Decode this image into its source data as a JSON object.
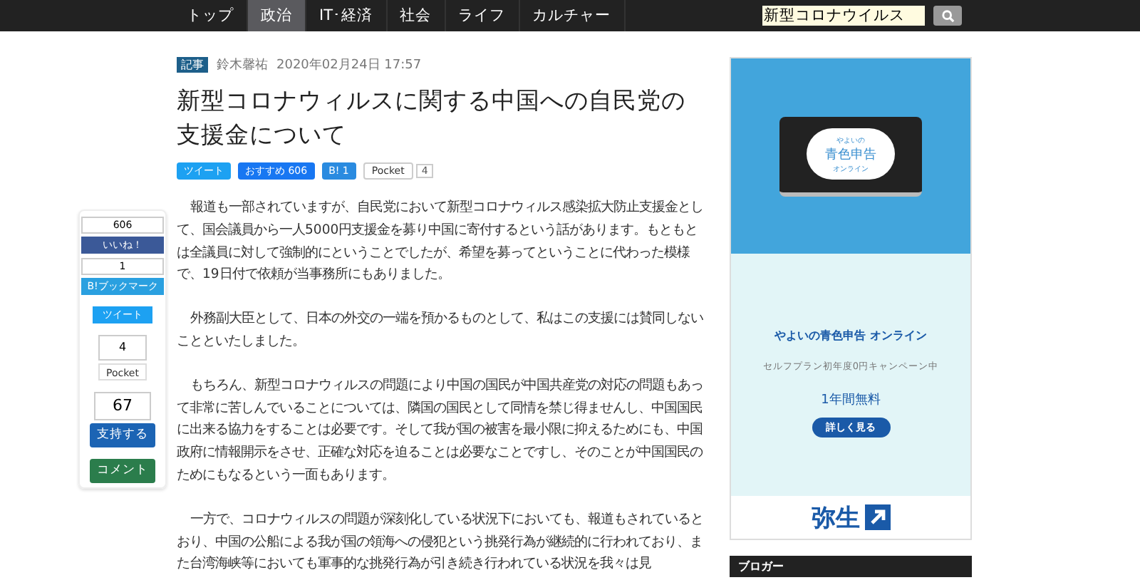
{
  "nav": {
    "items": [
      {
        "label": "トップ",
        "selected": false
      },
      {
        "label": "政治",
        "selected": true
      },
      {
        "label": "IT･経済",
        "selected": false
      },
      {
        "label": "社会",
        "selected": false
      },
      {
        "label": "ライフ",
        "selected": false
      },
      {
        "label": "カルチャー",
        "selected": false
      }
    ],
    "search": {
      "value": "新型コロナウイルス"
    }
  },
  "article": {
    "badge": "記事",
    "author": "鈴木馨祐",
    "date": "2020年02月24日 17:57",
    "title": "新型コロナウィルスに関する中国への自民党の支援金について",
    "share": [
      {
        "kind": "twitter",
        "label": "ツイート"
      },
      {
        "kind": "facebook",
        "label": "おすすめ",
        "count": "606"
      },
      {
        "kind": "hatena",
        "label": "B!",
        "count": "1"
      },
      {
        "kind": "pocket",
        "label": "Pocket",
        "count": "4"
      }
    ],
    "paragraphs": [
      "報道も一部されていますが、自民党において新型コロナウィルス感染拡大防止支援金として、国会議員から一人5000円支援金を募り中国に寄付するという話があります。もともとは全議員に対して強制的にということでしたが、希望を募ってということに代わった模様で、19日付で依頼が当事務所にもありました。",
      "外務副大臣として、日本の外交の一端を預かるものとして、私はこの支援には賛同しないことといたしました。",
      "もちろん、新型コロナウィルスの問題により中国の国民が中国共産党の対応の問題もあって非常に苦しんでいることについては、隣国の国民として同情を禁じ得ませんし、中国国民に出来る協力をすることは必要です。そして我が国の被害を最小限に抑えるためにも、中国政府に情報開示をさせ、正確な対応を迫ることは必要なことですし、そのことが中国国民のためにもなるという一面もあります。",
      "一方で、コロナウィルスの問題が深刻化している状況下においても、報道もされているとおり、中国の公船による我が国の領海への侵犯という挑発行為が継続的に行われており、また台湾海峡等においても軍事的な挑発行為が引き続き行われている状況を我々は見"
    ]
  },
  "side_share": {
    "like_count": "606",
    "like_label": "いいね！",
    "hatena_count": "1",
    "hatena_label": "B!ブックマーク",
    "tweet_label": "ツイート",
    "pocket_count": "4",
    "pocket_label": "Pocket",
    "support_count": "67",
    "support_label": "支持する",
    "comment_label": "コメント"
  },
  "ad": {
    "image_small": "やよいの",
    "image_title": "青色申告",
    "image_sub": "オンライン",
    "headline": "やよいの青色申告 オンライン",
    "campaign": "セルフプラン初年度0円キャンペーン中",
    "offer": "1年間無料",
    "cta": "詳しく見る",
    "brand": "弥生"
  },
  "sidebar_heading": "ブロガー"
}
